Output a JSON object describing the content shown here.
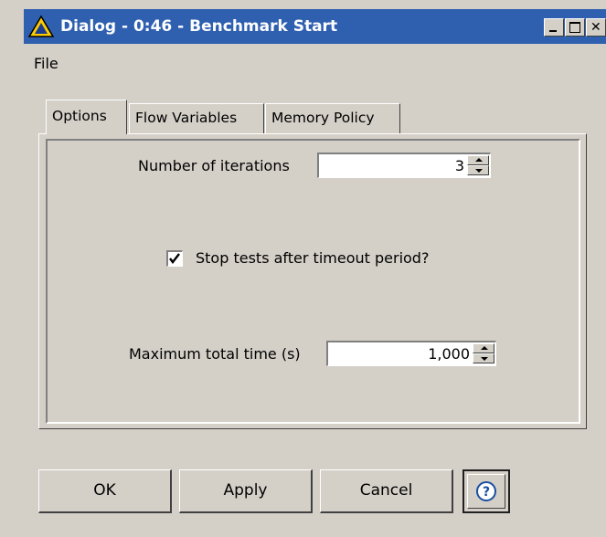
{
  "window": {
    "title": "Dialog - 0:46 - Benchmark Start",
    "controls": [
      "minimize-icon",
      "maximize-icon",
      "close-icon"
    ]
  },
  "menu": {
    "items": [
      "File"
    ]
  },
  "tabs": [
    {
      "label": "Options",
      "active": true
    },
    {
      "label": "Flow Variables",
      "active": false
    },
    {
      "label": "Memory Policy",
      "active": false
    }
  ],
  "options": {
    "iterations": {
      "label": "Number of iterations",
      "value": "3"
    },
    "timeout_checkbox": {
      "label": "Stop tests after timeout period?",
      "checked": true
    },
    "max_time": {
      "label": "Maximum total time (s)",
      "value": "1,000"
    }
  },
  "buttons": {
    "ok": "OK",
    "apply": "Apply",
    "cancel": "Cancel",
    "help_icon": "question-mark-icon"
  },
  "colors": {
    "titlebar": "#2f60b0",
    "window_bg": "#d4d0c8",
    "app_icon": "#ffcc00"
  }
}
